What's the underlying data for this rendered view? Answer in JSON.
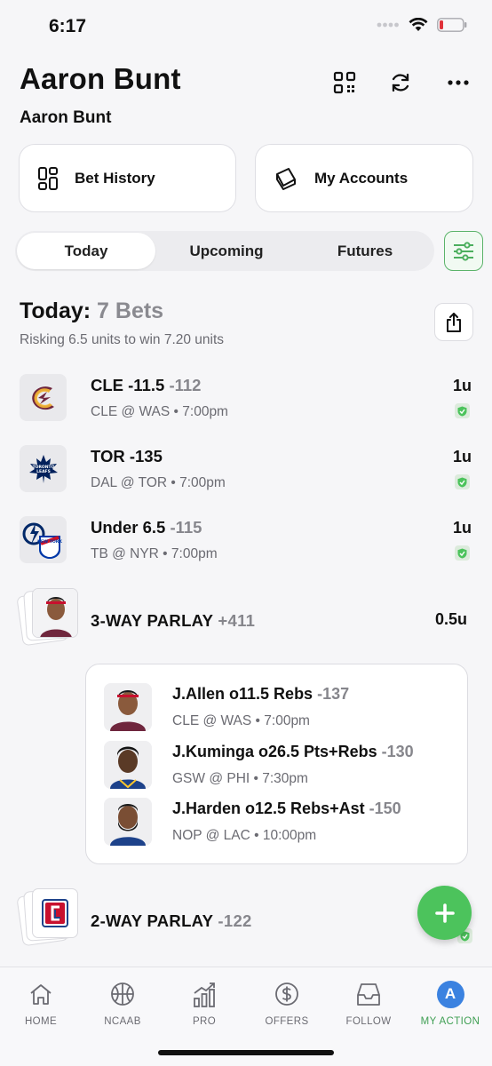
{
  "status_bar": {
    "time": "6:17"
  },
  "header": {
    "title": "Aaron Bunt",
    "subtitle": "Aaron Bunt"
  },
  "quick_actions": {
    "bet_history": "Bet History",
    "my_accounts": "My Accounts"
  },
  "tabs": [
    {
      "label": "Today",
      "active": true
    },
    {
      "label": "Upcoming",
      "active": false
    },
    {
      "label": "Futures",
      "active": false
    }
  ],
  "summary": {
    "title": "Today:",
    "count": "7 Bets",
    "risk_text": "Risking 6.5 units to win 7.20 units"
  },
  "bets": [
    {
      "pick": "CLE -11.5",
      "odds": "-112",
      "matchup": "CLE @ WAS • 7:00pm",
      "units": "1u",
      "logo": "cavaliers-logo"
    },
    {
      "pick": "TOR -135",
      "odds": "",
      "matchup": "DAL @ TOR • 7:00pm",
      "units": "1u",
      "logo": "maple-leafs-logo"
    },
    {
      "pick": "Under 6.5",
      "odds": "-115",
      "matchup": "TB @ NYR • 7:00pm",
      "units": "1u",
      "logo": "lightning-rangers-logo"
    }
  ],
  "parlays": [
    {
      "title": "3-WAY PARLAY",
      "odds": "+411",
      "units": "0.5u",
      "legs": [
        {
          "pick": "J.Allen o11.5 Rebs",
          "odds": "-137",
          "matchup": "CLE @ WAS • 7:00pm"
        },
        {
          "pick": "J.Kuminga o26.5 Pts+Rebs",
          "odds": "-130",
          "matchup": "GSW @ PHI • 7:30pm"
        },
        {
          "pick": "J.Harden o12.5 Rebs+Ast",
          "odds": "-150",
          "matchup": "NOP @ LAC • 10:00pm"
        }
      ]
    },
    {
      "title": "2-WAY PARLAY",
      "odds": "-122"
    }
  ],
  "bottom_nav": [
    {
      "label": "HOME",
      "icon": "home-icon"
    },
    {
      "label": "NCAAB",
      "icon": "basketball-icon"
    },
    {
      "label": "PRO",
      "icon": "bar-chart-icon"
    },
    {
      "label": "OFFERS",
      "icon": "dollar-icon"
    },
    {
      "label": "FOLLOW",
      "icon": "inbox-icon"
    },
    {
      "label": "MY ACTION",
      "icon": "avatar-icon",
      "avatar_letter": "A",
      "active": true
    }
  ],
  "colors": {
    "accent": "#4cc35c",
    "accent_text": "#3f9f53",
    "muted": "#86868c"
  }
}
